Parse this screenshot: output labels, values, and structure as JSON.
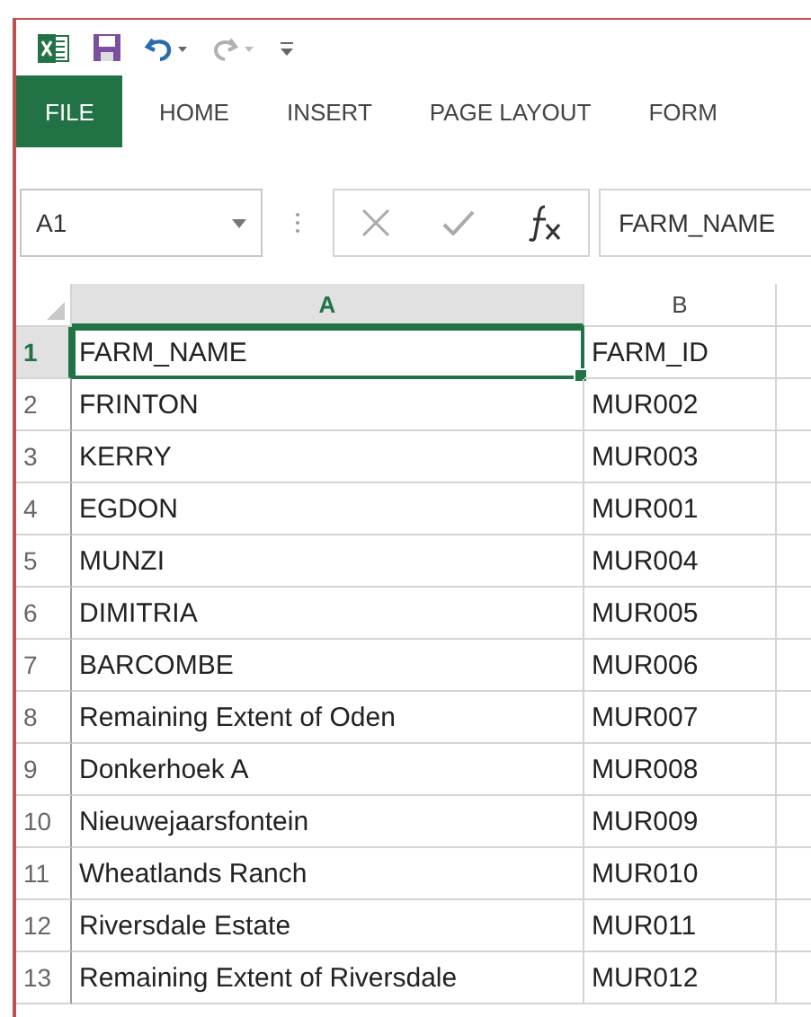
{
  "ribbon_tabs": [
    {
      "label": "FILE",
      "kind": "file"
    },
    {
      "label": "HOME",
      "kind": "tab"
    },
    {
      "label": "INSERT",
      "kind": "tab"
    },
    {
      "label": "PAGE LAYOUT",
      "kind": "tab"
    },
    {
      "label": "FORM",
      "kind": "tab"
    }
  ],
  "formula_bar": {
    "name_box": "A1",
    "formula": "FARM_NAME"
  },
  "columns": [
    {
      "label": "A",
      "selected": true
    },
    {
      "label": "B",
      "selected": false
    }
  ],
  "rows": [
    {
      "number": "1",
      "selected": true,
      "cells": [
        {
          "text": "FARM_NAME",
          "selected": true
        },
        {
          "text": "FARM_ID",
          "selected": false
        }
      ]
    },
    {
      "number": "2",
      "selected": false,
      "cells": [
        {
          "text": "FRINTON",
          "selected": false
        },
        {
          "text": "MUR002",
          "selected": false
        }
      ]
    },
    {
      "number": "3",
      "selected": false,
      "cells": [
        {
          "text": "KERRY",
          "selected": false
        },
        {
          "text": "MUR003",
          "selected": false
        }
      ]
    },
    {
      "number": "4",
      "selected": false,
      "cells": [
        {
          "text": "EGDON",
          "selected": false
        },
        {
          "text": "MUR001",
          "selected": false
        }
      ]
    },
    {
      "number": "5",
      "selected": false,
      "cells": [
        {
          "text": "MUNZI",
          "selected": false
        },
        {
          "text": "MUR004",
          "selected": false
        }
      ]
    },
    {
      "number": "6",
      "selected": false,
      "cells": [
        {
          "text": "DIMITRIA",
          "selected": false
        },
        {
          "text": "MUR005",
          "selected": false
        }
      ]
    },
    {
      "number": "7",
      "selected": false,
      "cells": [
        {
          "text": "BARCOMBE",
          "selected": false
        },
        {
          "text": "MUR006",
          "selected": false
        }
      ]
    },
    {
      "number": "8",
      "selected": false,
      "cells": [
        {
          "text": "Remaining Extent of Oden",
          "selected": false
        },
        {
          "text": "MUR007",
          "selected": false
        }
      ]
    },
    {
      "number": "9",
      "selected": false,
      "cells": [
        {
          "text": "Donkerhoek A",
          "selected": false
        },
        {
          "text": "MUR008",
          "selected": false
        }
      ]
    },
    {
      "number": "10",
      "selected": false,
      "cells": [
        {
          "text": "Nieuwejaarsfontein",
          "selected": false
        },
        {
          "text": "MUR009",
          "selected": false
        }
      ]
    },
    {
      "number": "11",
      "selected": false,
      "cells": [
        {
          "text": "Wheatlands Ranch",
          "selected": false
        },
        {
          "text": "MUR010",
          "selected": false
        }
      ]
    },
    {
      "number": "12",
      "selected": false,
      "cells": [
        {
          "text": "Riversdale Estate",
          "selected": false
        },
        {
          "text": "MUR011",
          "selected": false
        }
      ]
    },
    {
      "number": "13",
      "selected": false,
      "cells": [
        {
          "text": "Remaining Extent of Riversdale",
          "selected": false
        },
        {
          "text": "MUR012",
          "selected": false
        }
      ]
    }
  ]
}
